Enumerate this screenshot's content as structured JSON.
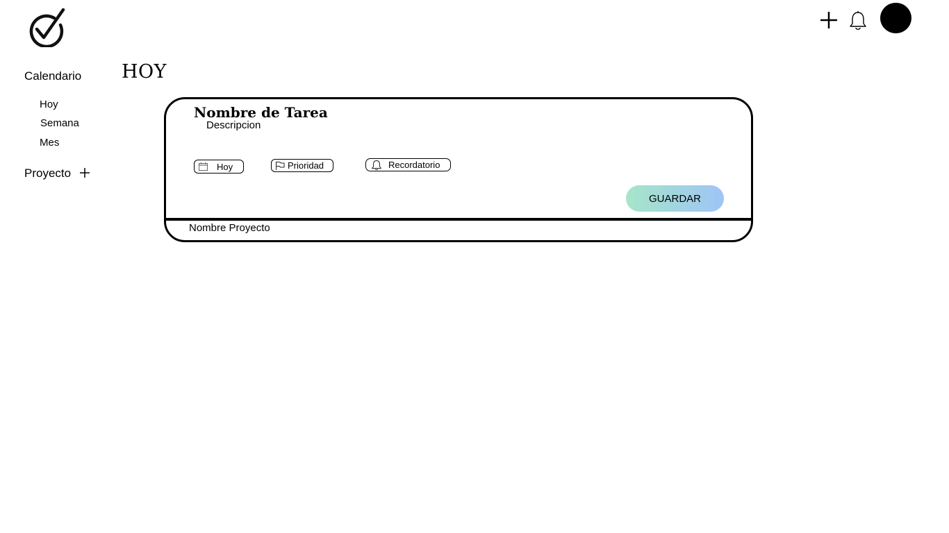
{
  "header": {
    "logo_icon": "check-circle-icon",
    "add_icon": "plus-icon",
    "notifications_icon": "bell-icon",
    "avatar": "user-avatar"
  },
  "sidebar": {
    "calendar_label": "Calendario",
    "calendar_items": [
      {
        "label": "Hoy"
      },
      {
        "label": "Semana"
      },
      {
        "label": "Mes"
      }
    ],
    "project_label": "Proyecto",
    "project_add_icon": "plus-icon"
  },
  "main": {
    "title": "HOY"
  },
  "task_form": {
    "name_placeholder": "Nombre de Tarea",
    "description_placeholder": "Descripcion",
    "chips": {
      "date": {
        "label": "Hoy",
        "icon": "calendar-icon"
      },
      "priority": {
        "label": "Prioridad",
        "icon": "flag-icon"
      },
      "reminder": {
        "label": "Recordatorio",
        "icon": "bell-icon"
      }
    },
    "save_label": "GUARDAR",
    "project_label": "Nombre Proyecto"
  },
  "colors": {
    "save_gradient_start": "#a6e6c9",
    "save_gradient_end": "#9fc4f6"
  }
}
